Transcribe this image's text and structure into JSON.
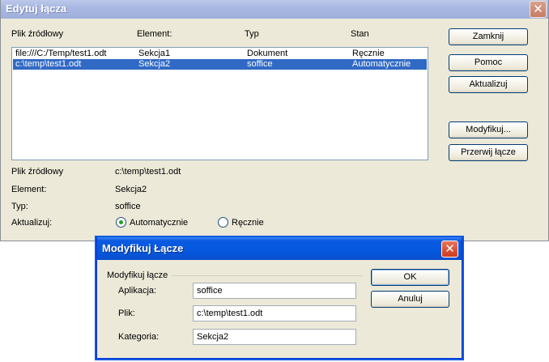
{
  "main": {
    "title": "Edytuj łącza",
    "headers": {
      "source": "Plik źródłowy",
      "element": "Element:",
      "type": "Typ",
      "status": "Stan"
    },
    "rows": [
      {
        "source": "file:///C:/Temp/test1.odt",
        "element": "Sekcja1",
        "type": "Dokument",
        "status": "Ręcznie",
        "selected": false
      },
      {
        "source": "c:\\temp\\test1.odt",
        "element": "Sekcja2",
        "type": "soffice",
        "status": "Automatycznie",
        "selected": true
      }
    ],
    "buttons": {
      "close": "Zamknij",
      "help": "Pomoc",
      "update": "Aktualizuj",
      "modify": "Modyfikuj...",
      "break": "Przerwij łącze"
    },
    "details": {
      "source_label": "Plik źródłowy",
      "source_value": "c:\\temp\\test1.odt",
      "element_label": "Element:",
      "element_value": "Sekcja2",
      "type_label": "Typ:",
      "type_value": "soffice",
      "update_label": "Aktualizuj:",
      "auto_label": "Automatycznie",
      "manual_label": "Ręcznie",
      "update_mode": "auto"
    }
  },
  "dialog": {
    "title": "Modyfikuj Łącze",
    "group_label": "Modyfikuj łącze",
    "fields": {
      "app_label": "Aplikacja:",
      "app_value": "soffice",
      "file_label": "Plik:",
      "file_value": "c:\\temp\\test1.odt",
      "category_label": "Kategoria:",
      "category_value": "Sekcja2"
    },
    "buttons": {
      "ok": "OK",
      "cancel": "Anuluj"
    }
  },
  "colors": {
    "selection": "#316ac5",
    "dialog_title": "#0a5ae0",
    "inactive_title": "#a9b8e2"
  }
}
